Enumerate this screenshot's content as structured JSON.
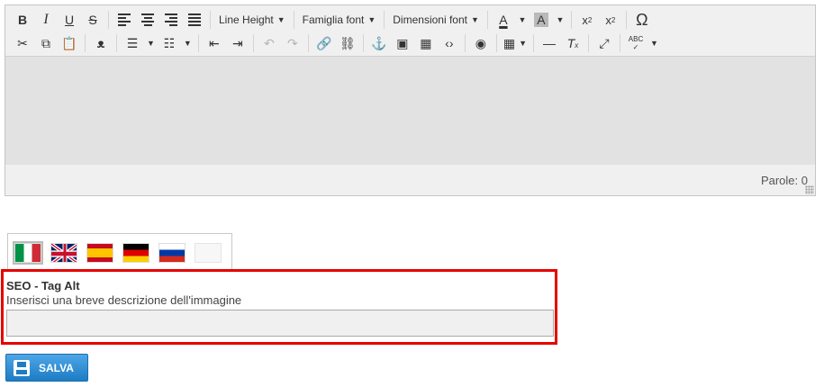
{
  "toolbar": {
    "line_height": "Line Height",
    "font_family": "Famiglia font",
    "font_size": "Dimensioni font",
    "omega": "Ω",
    "text_color_letter": "A",
    "bg_color_letter": "A",
    "spellcheck": "ABC"
  },
  "editor": {
    "word_count": "Parole: 0"
  },
  "languages": [
    "it",
    "en",
    "es",
    "de",
    "ru",
    ""
  ],
  "seo": {
    "title": "SEO - Tag Alt",
    "hint": "Inserisci una breve descrizione dell'immagine",
    "value": ""
  },
  "save_button": {
    "label": "SALVA"
  },
  "colors": {
    "highlight_border": "#e60000",
    "button": "#1d7cc4"
  }
}
